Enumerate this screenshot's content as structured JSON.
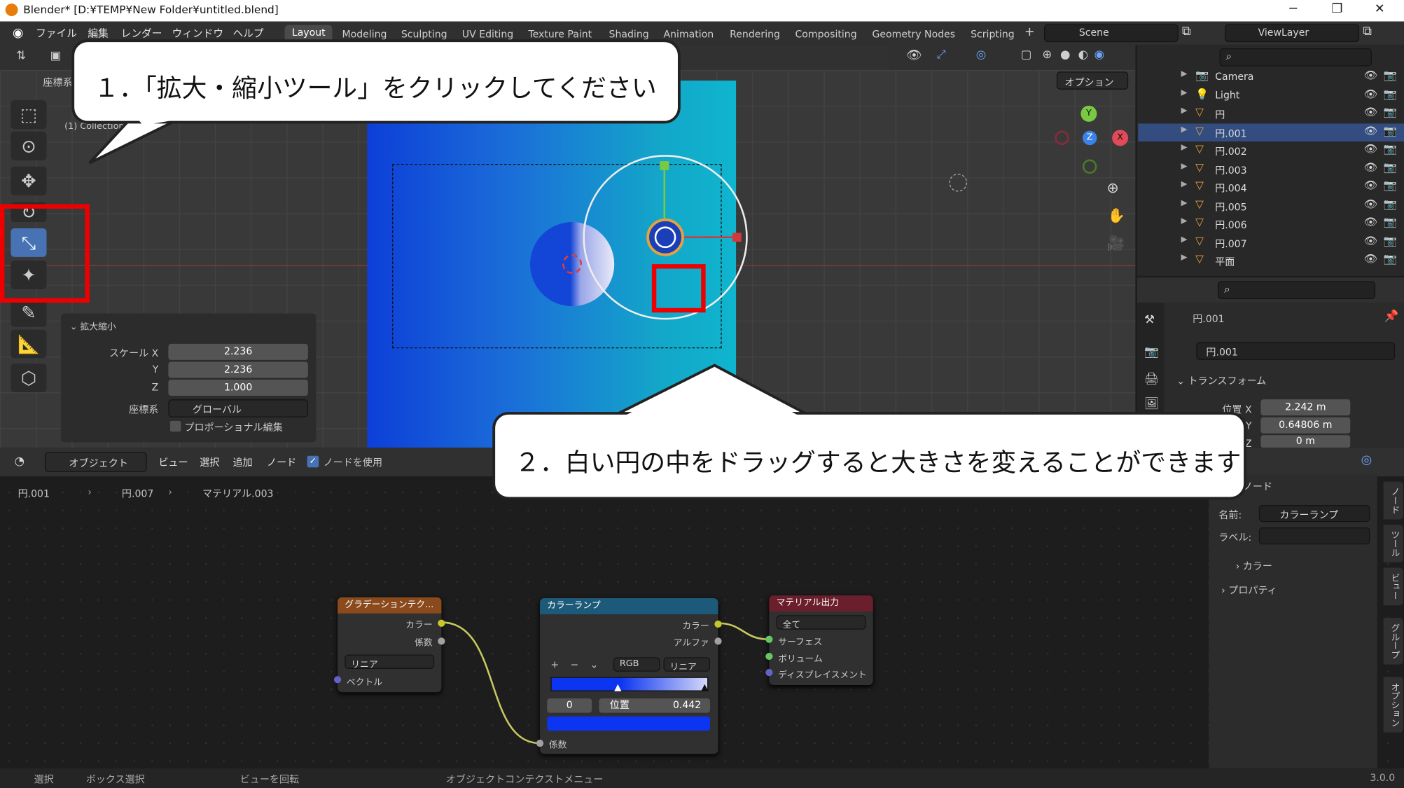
{
  "window": {
    "title": "Blender* [D:¥TEMP¥New Folder¥untitled.blend]",
    "min": "─",
    "max": "❐",
    "close": "✕"
  },
  "menus": [
    "ファイル",
    "編集",
    "レンダー",
    "ウィンドウ",
    "ヘルプ"
  ],
  "workspaces": [
    "Layout",
    "Modeling",
    "Sculpting",
    "UV Editing",
    "Texture Paint",
    "Shading",
    "Animation",
    "Rendering",
    "Compositing",
    "Geometry Nodes",
    "Scripting"
  ],
  "scene": "Scene",
  "view_layer": "ViewLayer",
  "viewport": {
    "coord_label": "座標系",
    "options": "オプション",
    "collection": "(1) Collection | 円.007"
  },
  "tool_panel": {
    "title": "拡大縮小",
    "rows": [
      {
        "label": "スケール X",
        "value": "2.236"
      },
      {
        "label": "Y",
        "value": "2.236"
      },
      {
        "label": "Z",
        "value": "1.000"
      }
    ],
    "coord_label": "座標系",
    "coord_value": "グローバル",
    "proportional": "プロポーショナル編集"
  },
  "gizmo": {
    "x": "X",
    "y": "Y",
    "z": "Z"
  },
  "outliner": [
    {
      "name": "Camera"
    },
    {
      "name": "Light"
    },
    {
      "name": "円"
    },
    {
      "name": "円.001",
      "selected": true
    },
    {
      "name": "円.002"
    },
    {
      "name": "円.003"
    },
    {
      "name": "円.004"
    },
    {
      "name": "円.005"
    },
    {
      "name": "円.006"
    },
    {
      "name": "円.007"
    },
    {
      "name": "平面"
    }
  ],
  "properties": {
    "object": "円.001",
    "data": "円.001",
    "section": "トランスフォーム",
    "rows": [
      {
        "label": "位置 X",
        "value": "2.242 m"
      },
      {
        "label": "Y",
        "value": "0.64806 m"
      },
      {
        "label": "Z",
        "value": "0 m"
      }
    ]
  },
  "node_header": {
    "object": "オブジェクト",
    "menus": [
      "ビュー",
      "選択",
      "追加",
      "ノード"
    ],
    "use_nodes": "ノードを使用"
  },
  "breadcrumb": [
    "円.001",
    "円.007",
    "マテリアル.003"
  ],
  "nodes": {
    "gradient": {
      "title": "グラデーションテク...",
      "out1": "カラー",
      "out2": "係数",
      "mode": "リニア",
      "in1": "ベクトル"
    },
    "ramp": {
      "title": "カラーランプ",
      "out1": "カラー",
      "out2": "アルファ",
      "color_mode": "RGB",
      "interp": "リニア",
      "index": "0",
      "pos_label": "位置",
      "pos_value": "0.442",
      "in1": "係数"
    },
    "output": {
      "title": "マテリアル出力",
      "target": "全て",
      "in1": "サーフェス",
      "in2": "ボリューム",
      "in3": "ディスプレイスメント"
    }
  },
  "node_sidebar": {
    "header": "ノード",
    "name_label": "名前:",
    "name_value": "カラーランプ",
    "label_label": "ラベル:",
    "color": "カラー",
    "props": "プロパティ",
    "tabs": [
      "ノード",
      "ツール",
      "ビュー",
      "グループ",
      "オプション"
    ]
  },
  "status": {
    "select": "選択",
    "box": "ボックス選択",
    "rotate": "ビューを回転",
    "context": "オブジェクトコンテクストメニュー",
    "version": "3.0.0"
  },
  "callouts": {
    "step1": "１．「拡大・縮小ツール」をクリックしてください",
    "step2": "２．白い円の中をドラッグすると大きさを変えることができます"
  },
  "colors": {
    "accent": "#4772b3",
    "highlight": "#e00000",
    "selected_row": "#334d80"
  }
}
